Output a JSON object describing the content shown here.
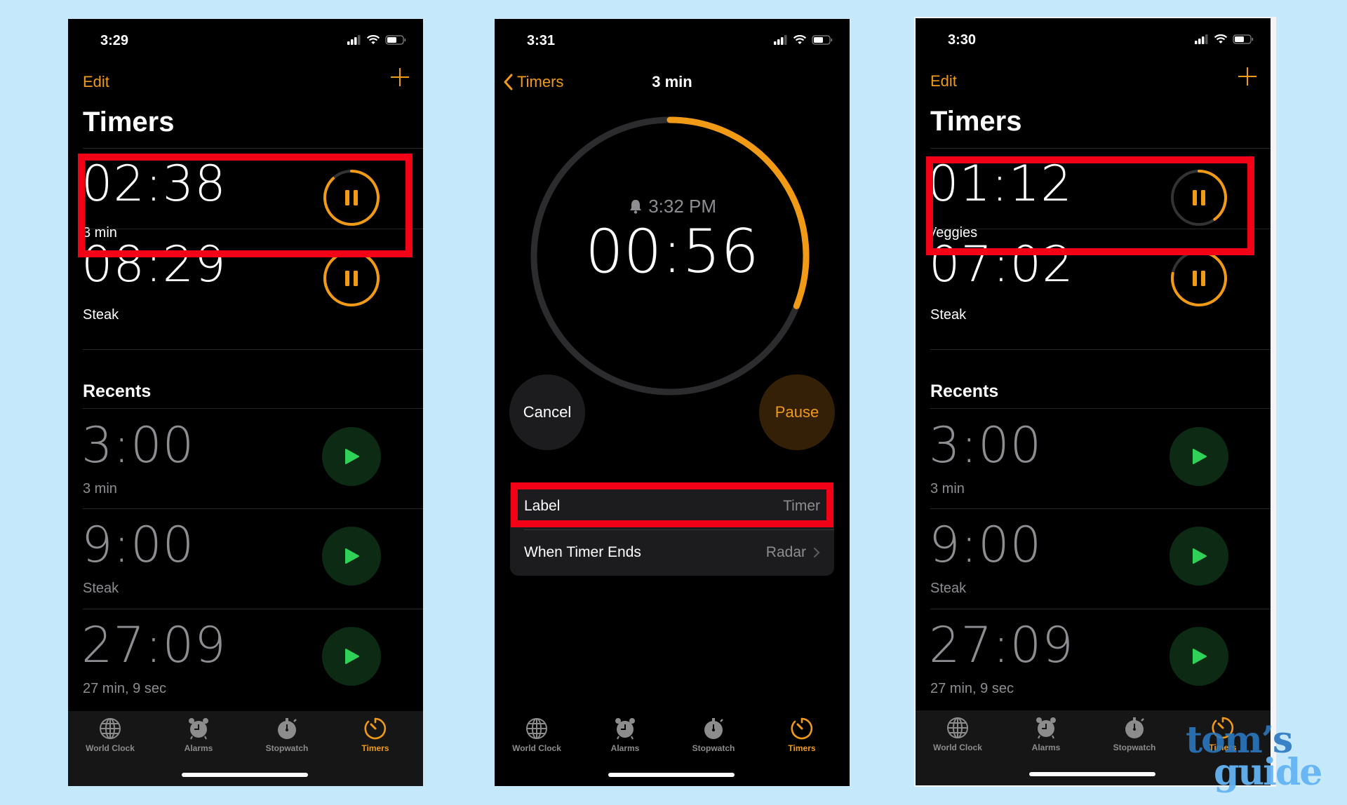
{
  "colors": {
    "background": "#c6e8fb",
    "accent_orange": "#f19a16",
    "play_green": "#30d158",
    "highlight_red": "#f30217"
  },
  "tabs": [
    {
      "label": "World Clock",
      "icon": "globe-icon"
    },
    {
      "label": "Alarms",
      "icon": "alarm-clock-icon"
    },
    {
      "label": "Stopwatch",
      "icon": "stopwatch-icon"
    },
    {
      "label": "Timers",
      "icon": "timer-icon",
      "selected": true
    }
  ],
  "phone1": {
    "status_time": "3:29",
    "edit_label": "Edit",
    "title": "Timers",
    "active_timers": [
      {
        "time": "02:38",
        "label": "3 min",
        "progress_remaining": 0.88,
        "highlighted": true
      },
      {
        "time": "08:29",
        "label": "Steak",
        "progress_remaining": 0.94
      }
    ],
    "recents_heading": "Recents",
    "recents": [
      {
        "time": "3:00",
        "label": "3 min"
      },
      {
        "time": "9:00",
        "label": "Steak"
      },
      {
        "time": "27:09",
        "label": "27 min, 9 sec"
      }
    ]
  },
  "phone2": {
    "status_time": "3:31",
    "back_label": "Timers",
    "nav_title": "3 min",
    "end_time": "3:32 PM",
    "remaining": "00:56",
    "progress_remaining": 0.31,
    "cancel_label": "Cancel",
    "pause_label": "Pause",
    "settings": [
      {
        "label": "Label",
        "value": "Timer",
        "highlighted": true
      },
      {
        "label": "When Timer Ends",
        "value": "Radar"
      }
    ]
  },
  "phone3": {
    "status_time": "3:30",
    "edit_label": "Edit",
    "title": "Timers",
    "active_timers": [
      {
        "time": "01:12",
        "label": "Veggies",
        "progress_remaining": 0.4,
        "highlighted": true
      },
      {
        "time": "07:02",
        "label": "Steak",
        "progress_remaining": 0.78
      }
    ],
    "recents_heading": "Recents",
    "recents": [
      {
        "time": "3:00",
        "label": "3 min"
      },
      {
        "time": "9:00",
        "label": "Steak"
      },
      {
        "time": "27:09",
        "label": "27 min, 9 sec"
      }
    ]
  },
  "watermark": {
    "line1": "tom’s",
    "line2": "guide"
  }
}
